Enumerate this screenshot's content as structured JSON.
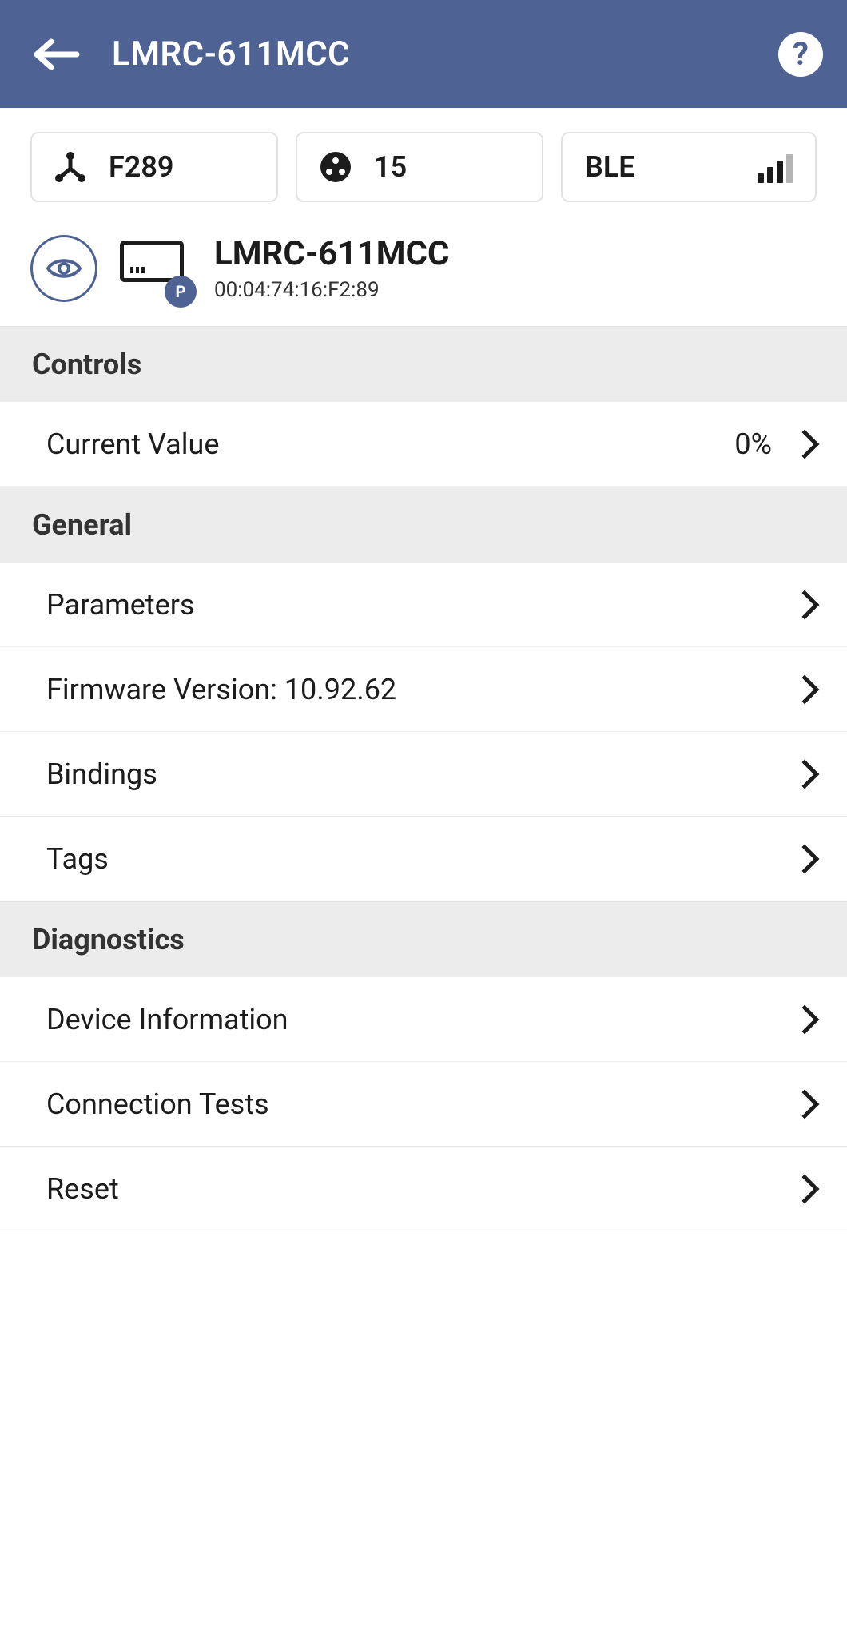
{
  "header": {
    "title": "LMRC-611MCC"
  },
  "chips": {
    "hub_code": "F289",
    "channel_count": "15",
    "connection_type": "BLE"
  },
  "device": {
    "name": "LMRC-611MCC",
    "mac": "00:04:74:16:F2:89",
    "badge_letter": "P"
  },
  "sections": {
    "controls": {
      "title": "Controls",
      "rows": {
        "current_value": {
          "label": "Current Value",
          "value": "0%"
        }
      }
    },
    "general": {
      "title": "General",
      "rows": {
        "parameters": {
          "label": "Parameters"
        },
        "firmware": {
          "label": "Firmware Version: 10.92.62"
        },
        "bindings": {
          "label": "Bindings"
        },
        "tags": {
          "label": "Tags"
        }
      }
    },
    "diagnostics": {
      "title": "Diagnostics",
      "rows": {
        "device_info": {
          "label": "Device Information"
        },
        "connection_tests": {
          "label": "Connection Tests"
        },
        "reset": {
          "label": "Reset"
        }
      }
    }
  }
}
